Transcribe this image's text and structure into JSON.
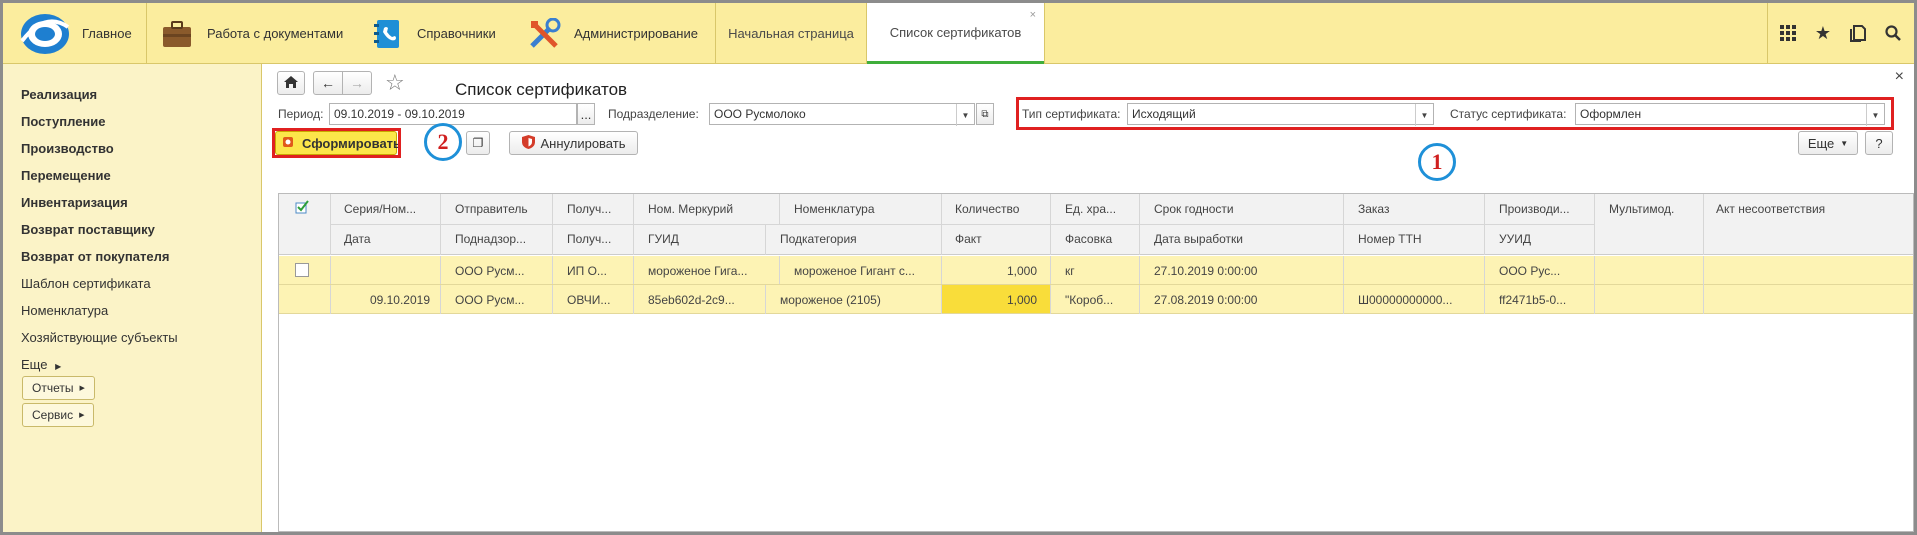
{
  "topbar": {
    "home_label": "Главное",
    "sections": [
      {
        "label": "Работа с документами",
        "icon": "briefcase-icon"
      },
      {
        "label": "Справочники",
        "icon": "address-book-icon"
      },
      {
        "label": "Администрирование",
        "icon": "tools-icon"
      }
    ],
    "tabs": [
      {
        "label": "Начальная страница"
      },
      {
        "label": "Список сертификатов",
        "close": "×"
      }
    ],
    "tools": [
      "apps-grid-icon",
      "star-icon",
      "history-icon",
      "search-icon"
    ]
  },
  "sidebar": {
    "items": [
      {
        "label": "Реализация",
        "bold": true
      },
      {
        "label": "Поступление",
        "bold": true
      },
      {
        "label": "Производство",
        "bold": true
      },
      {
        "label": "Перемещение",
        "bold": true
      },
      {
        "label": "Инвентаризация",
        "bold": true
      },
      {
        "label": "Возврат поставщику",
        "bold": true
      },
      {
        "label": "Возврат от покупателя",
        "bold": true
      },
      {
        "label": "Шаблон сертификата",
        "bold": false
      },
      {
        "label": "Номенклатура",
        "bold": false
      },
      {
        "label": "Хозяйствующие субъекты",
        "bold": false
      },
      {
        "label": "Еще",
        "bold": false
      }
    ],
    "buttons": [
      "Отчеты",
      "Сервис"
    ]
  },
  "form": {
    "title": "Список сертификатов",
    "close": "×",
    "period_label": "Период:",
    "period_value": "09.10.2019 - 09.10.2019",
    "period_btn": "...",
    "division_label": "Подразделение:",
    "division_value": "ООО Русмолоко",
    "cert_type_label": "Тип сертификата:",
    "cert_type_value": "Исходящий",
    "cert_status_label": "Статус сертификата:",
    "cert_status_value": "Оформлен",
    "form_button": "Сформировать",
    "cancel_button": "Аннулировать",
    "more_button": "Еще",
    "help_button": "?",
    "marker_1": "1",
    "marker_2": "2"
  },
  "table": {
    "header_top": [
      "Серия/Ном...",
      "Отправитель",
      "Получ...",
      "Ном. Меркурий",
      "Номенклатура",
      "Количество",
      "Ед. хра...",
      "Срок годности",
      "Заказ",
      "Производи...",
      "Мультимод.",
      "Акт несоответствия"
    ],
    "header_bottom": [
      "Дата",
      "Поднадзор...",
      "Получ...",
      "ГУИД",
      "Подкатегория",
      "Факт",
      "Фасовка",
      "Дата выработки",
      "Номер ТТН",
      "УУИД"
    ],
    "rows": [
      {
        "top": [
          "",
          "ООО Русм...",
          "ИП О...",
          "мороженое Гига...",
          "мороженое Гигант с...",
          "1,000",
          "кг",
          "27.10.2019 0:00:00",
          "",
          "ООО Рус...",
          "",
          ""
        ],
        "bottom": [
          "09.10.2019",
          "ООО Русм...",
          "ОВЧИ...",
          "85eb602d-2c9...",
          "мороженое (2105)",
          "1,000",
          "\"Короб...",
          "27.08.2019 0:00:00",
          "Ш00000000000...",
          "ff2471b5-0..."
        ]
      }
    ]
  },
  "colors": {
    "topbar": "#fbed9e",
    "sidebar": "#fbf3c7",
    "row_highlight": "#fdf3b4",
    "qty_highlight": "#f9dd3a",
    "annotation_red": "#e02020",
    "annotation_blue": "#1e90d8"
  }
}
